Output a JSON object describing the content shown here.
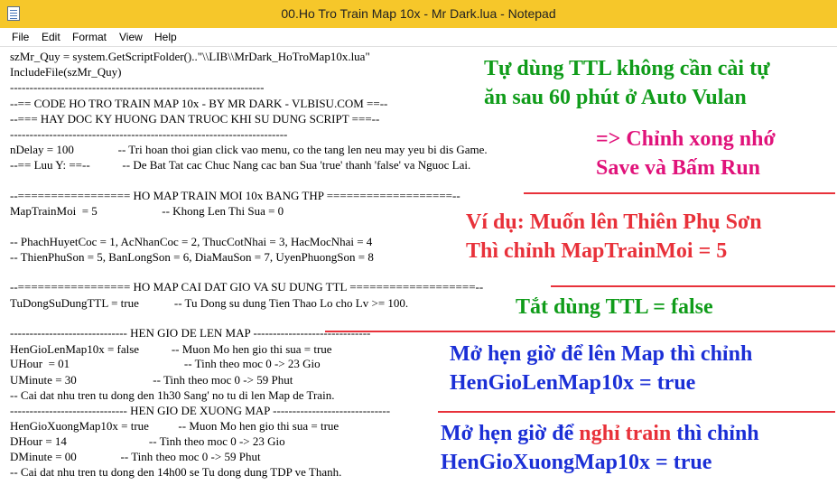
{
  "window": {
    "title": "00.Ho Tro Train Map 10x - Mr Dark.lua - Notepad"
  },
  "menu": [
    "File",
    "Edit",
    "Format",
    "View",
    "Help"
  ],
  "code_lines": [
    "szMr_Quy = system.GetScriptFolder()..\"\\\\LIB\\\\MrDark_HoTroMap10x.lua\"",
    "IncludeFile(szMr_Quy)",
    "-----------------------------------------------------------------",
    "--== CODE HO TRO TRAIN MAP 10x - BY MR DARK - VLBISU.COM ==--",
    "--=== HAY DOC KY HUONG DAN TRUOC KHI SU DUNG SCRIPT ===--",
    "-----------------------------------------------------------------------",
    "nDelay = 100               -- Tri hoan thoi gian click vao menu, co the tang len neu may yeu bi dis Game.",
    "--== Luu Y: ==--           -- De Bat Tat cac Chuc Nang cac ban Sua 'true' thanh 'false' va Nguoc Lai.",
    "",
    "--================= HO MAP TRAIN MOI 10x BANG THP ===================--",
    "MapTrainMoi  = 5                      -- Khong Len Thi Sua = 0",
    "",
    "-- PhachHuyetCoc = 1, AcNhanCoc = 2, ThucCotNhai = 3, HacMocNhai = 4",
    "-- ThienPhuSon = 5, BanLongSon = 6, DiaMauSon = 7, UyenPhuongSon = 8",
    "",
    "--================= HO MAP CAI DAT GIO VA SU DUNG TTL ===================--",
    "TuDongSuDungTTL = true            -- Tu Dong su dung Tien Thao Lo cho Lv >= 100.",
    "",
    "------------------------------ HEN GIO DE LEN MAP ------------------------------",
    "HenGioLenMap10x = false           -- Muon Mo hen gio thi sua = true",
    "UHour  = 01                                       -- Tinh theo moc 0 -> 23 Gio",
    "UMinute = 30                          -- Tinh theo moc 0 -> 59 Phut",
    "-- Cai dat nhu tren tu dong den 1h30 Sang' no tu di len Map de Train.",
    "------------------------------ HEN GIO DE XUONG MAP ------------------------------",
    "HenGioXuongMap10x = true          -- Muon Mo hen gio thi sua = true",
    "DHour = 14                            -- Tinh theo moc 0 -> 23 Gio",
    "DMinute = 00               -- Tinh theo moc 0 -> 59 Phut",
    "-- Cai dat nhu tren tu dong den 14h00 se Tu dong dung TDP ve Thanh."
  ],
  "annotations": {
    "ttl_line1": "Tự dùng TTL không cần cài tự",
    "ttl_line2": "ăn sau 60 phút ở Auto Vulan",
    "save_line1": "=> Chỉnh xong nhớ",
    "save_line2": "Save và Bấm Run",
    "example_line1": "Ví dụ: Muốn lên Thiên Phụ Sơn",
    "example_line2": "Thì chỉnh MapTrainMoi = 5",
    "off_ttl": "Tắt dùng TTL = false",
    "up_line1": "Mở hẹn giờ để lên Map thì chỉnh",
    "up_line2": "HenGioLenMap10x = true",
    "down_line1_a": "Mở hẹn giờ để ",
    "down_line1_b": "nghỉ train",
    "down_line1_c": " thì chỉnh",
    "down_line2": "HenGioXuongMap10x = true"
  },
  "colors": {
    "titlebar": "#f6c72a",
    "green": "#109c1a",
    "pink": "#e0127a",
    "red": "#e8313a",
    "blue": "#1b2fd6"
  }
}
